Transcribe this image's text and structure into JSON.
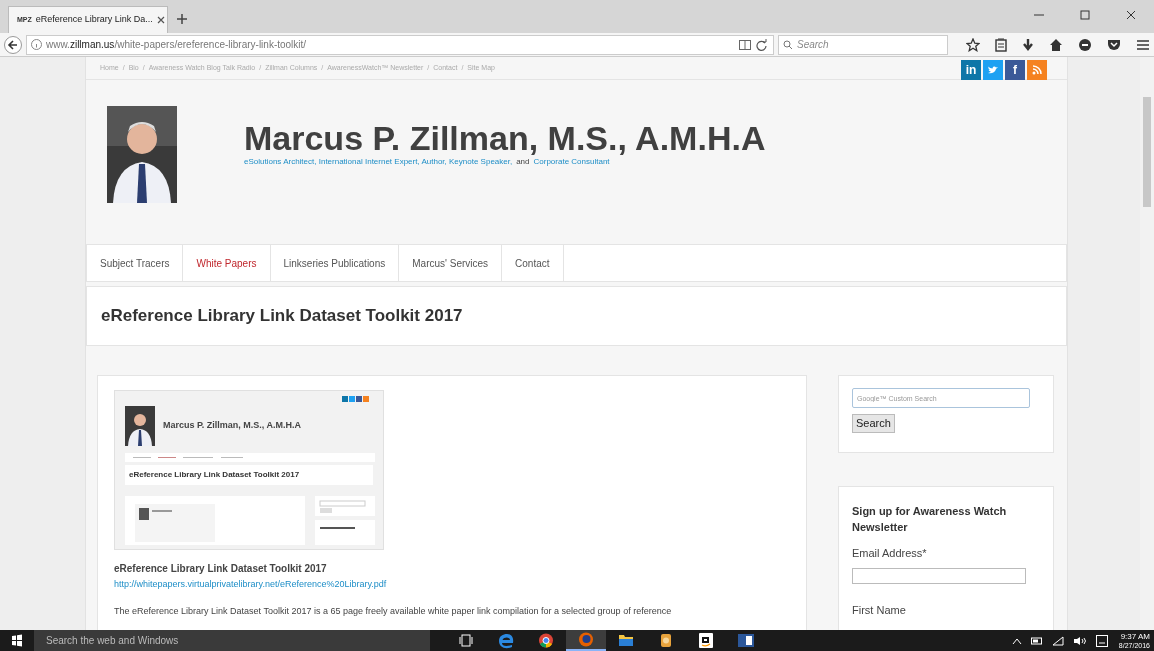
{
  "browser": {
    "tab": {
      "favicon": "MPZ",
      "title": "eReference Library Link Da...",
      "selected": true
    },
    "url": "www.**zillman.us**/white-papers/ereference-library-link-toolkit/",
    "search_placeholder": "Search"
  },
  "breadcrumb": {
    "separator": "/",
    "items": [
      "Home",
      "Bio",
      "Awareness Watch Blog Talk Radio",
      "Zillman Columns",
      "AwarenessWatch™ Newsletter",
      "Contact",
      "Site Map"
    ]
  },
  "social": [
    {
      "kind": "linkedin",
      "label": "in",
      "color": "#0e76a8"
    },
    {
      "kind": "twitter",
      "color": "#1da1f2"
    },
    {
      "kind": "facebook",
      "label": "f",
      "color": "#3b5998"
    },
    {
      "kind": "rss",
      "color": "#f58220"
    }
  ],
  "header": {
    "name": "Marcus P. Zillman, M.S., A.M.H.A",
    "tagline": [
      {
        "text": "eSolutions Architect, International Internet Expert, Author, Keynote Speaker,",
        "link": true
      },
      {
        "text": "and",
        "link": false
      },
      {
        "text": "Corporate Consultant",
        "link": true
      }
    ]
  },
  "nav": [
    {
      "label": "Subject Tracers",
      "selected": false
    },
    {
      "label": "White Papers",
      "selected": true
    },
    {
      "label": "Linkseries Publications",
      "selected": false
    },
    {
      "label": "Marcus' Services",
      "selected": false
    },
    {
      "label": "Contact",
      "selected": false
    }
  ],
  "page_title": "eReference Library Link Dataset Toolkit 2017",
  "article": {
    "thumbnail": {
      "name": "Marcus P. Zillman, M.S., A.M.H.A",
      "title": "eReference Library Link Dataset Toolkit 2017"
    },
    "heading": "eReference Library Link Dataset Toolkit 2017",
    "link": "http://whitepapers.virtualprivatelibrary.net/eReference%20Library.pdf",
    "body": "The eReference Library Link Dataset Toolkit 2017 is a 65 page freely available white paper link compilation for a selected group of reference"
  },
  "sidebar": {
    "search": {
      "placeholder": "Google™ Custom Search",
      "button": "Search"
    },
    "newsletter": {
      "title": "Sign up for Awareness Watch Newsletter",
      "fields": [
        "Email Address*",
        "First Name"
      ]
    }
  },
  "taskbar": {
    "search_placeholder": "Search the web and Windows",
    "apps": [
      {
        "kind": "taskview",
        "active": false
      },
      {
        "kind": "edge",
        "active": false
      },
      {
        "kind": "chrome",
        "active": false
      },
      {
        "kind": "firefox",
        "active": true
      },
      {
        "kind": "explorer",
        "active": false
      },
      {
        "kind": "app",
        "active": false
      },
      {
        "kind": "amazon",
        "active": false
      },
      {
        "kind": "word",
        "active": false
      }
    ],
    "time": "9:37 AM",
    "date": "8/27/2016"
  }
}
